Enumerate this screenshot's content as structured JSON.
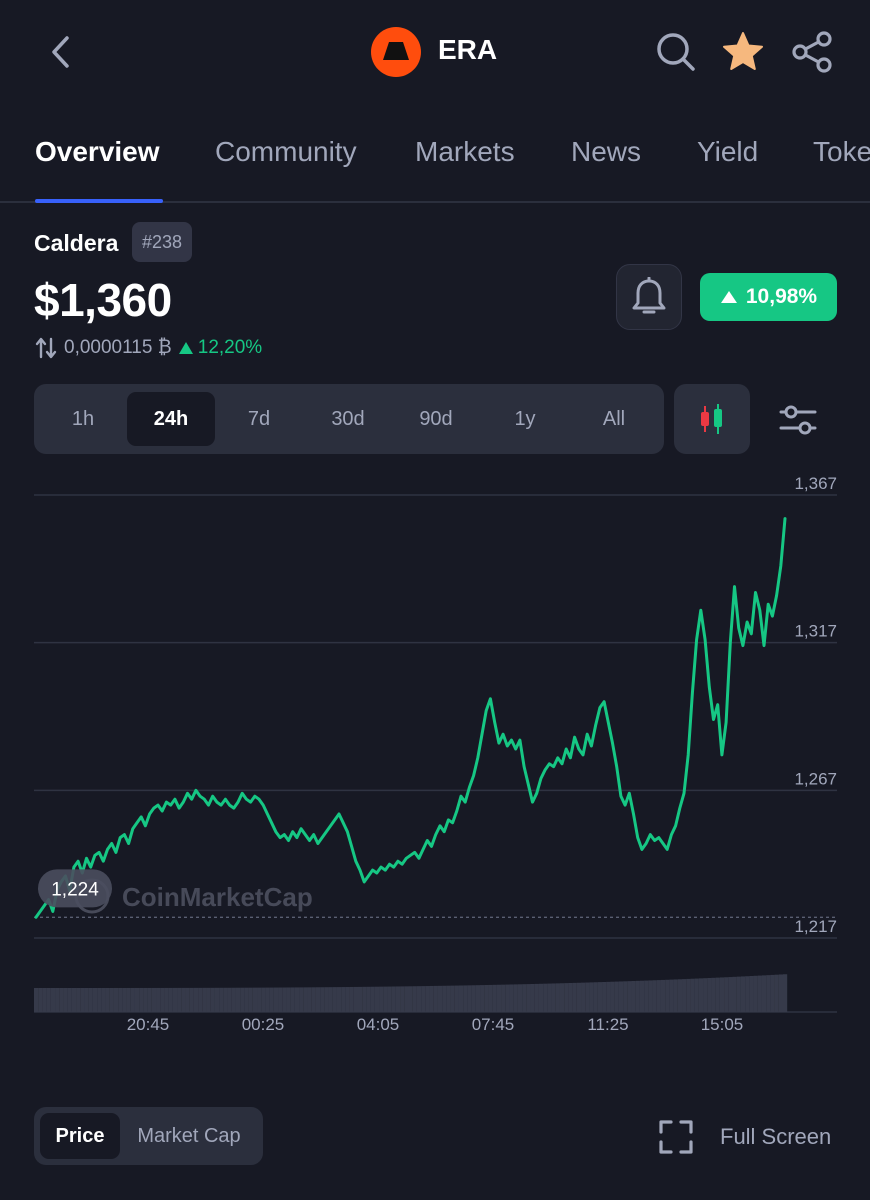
{
  "header": {
    "back_icon": "chevron-left-icon",
    "symbol": "ERA",
    "logo_color": "#ff4d0d",
    "icons": [
      "search-icon",
      "star-icon",
      "share-icon"
    ],
    "star_color": "#f6b87e"
  },
  "tabs": [
    {
      "label": "Overview",
      "active": true
    },
    {
      "label": "Community",
      "active": false
    },
    {
      "label": "Markets",
      "active": false
    },
    {
      "label": "News",
      "active": false
    },
    {
      "label": "Yield",
      "active": false
    },
    {
      "label": "Toke",
      "active": false
    }
  ],
  "coin": {
    "name": "Caldera",
    "rank": "#238",
    "price": "$1,360",
    "btc_price": "0,0000115 ₿",
    "btc_change": "12,20%",
    "change_24h": "10,98%"
  },
  "colors": {
    "positive": "#16c784",
    "accent": "#3861fb",
    "background": "#171924",
    "panel": "#2b2f3d",
    "muted_text": "#a1a7bb"
  },
  "ranges": [
    {
      "label": "1h",
      "active": false
    },
    {
      "label": "24h",
      "active": true
    },
    {
      "label": "7d",
      "active": false
    },
    {
      "label": "30d",
      "active": false
    },
    {
      "label": "90d",
      "active": false
    },
    {
      "label": "1y",
      "active": false
    },
    {
      "label": "All",
      "active": false
    }
  ],
  "chart_data": {
    "type": "line",
    "y_ticks": [
      "1,367",
      "1,317",
      "1,267",
      "1,217"
    ],
    "ylim": [
      1217,
      1367
    ],
    "x_ticks": [
      "20:45",
      "00:25",
      "04:05",
      "07:45",
      "11:25",
      "15:05"
    ],
    "start_price_label": "1,224",
    "start_price": 1224,
    "watermark": "CoinMarketCap",
    "line_color": "#16c784",
    "series": [
      {
        "values": [
          1224,
          1226,
          1228,
          1230,
          1226,
          1233,
          1236,
          1238,
          1233,
          1241,
          1243,
          1239,
          1244,
          1241,
          1245,
          1246,
          1243,
          1247,
          1249,
          1246,
          1251,
          1252,
          1249,
          1254,
          1256,
          1258,
          1255,
          1259,
          1261,
          1262,
          1260,
          1263,
          1262,
          1264,
          1261,
          1263,
          1266,
          1264,
          1267,
          1265,
          1264,
          1262,
          1265,
          1263,
          1262,
          1264,
          1262,
          1261,
          1263,
          1266,
          1264,
          1263,
          1265,
          1264,
          1262,
          1259,
          1256,
          1253,
          1251,
          1252,
          1250,
          1253,
          1251,
          1254,
          1252,
          1250,
          1252,
          1249,
          1251,
          1253,
          1255,
          1257,
          1259,
          1256,
          1253,
          1248,
          1243,
          1240,
          1236,
          1238,
          1240,
          1239,
          1241,
          1240,
          1242,
          1241,
          1243,
          1242,
          1244,
          1245,
          1246,
          1244,
          1247,
          1250,
          1248,
          1252,
          1255,
          1253,
          1257,
          1256,
          1260,
          1265,
          1263,
          1268,
          1272,
          1278,
          1286,
          1294,
          1298,
          1290,
          1283,
          1286,
          1282,
          1284,
          1281,
          1284,
          1275,
          1269,
          1263,
          1266,
          1271,
          1274,
          1276,
          1275,
          1278,
          1276,
          1281,
          1278,
          1285,
          1281,
          1279,
          1286,
          1282,
          1289,
          1295,
          1297,
          1290,
          1283,
          1275,
          1265,
          1262,
          1266,
          1259,
          1251,
          1247,
          1249,
          1252,
          1250,
          1251,
          1249,
          1247,
          1252,
          1255,
          1261,
          1266,
          1279,
          1300,
          1318,
          1328,
          1318,
          1302,
          1291,
          1296,
          1279,
          1290,
          1317,
          1336,
          1322,
          1316,
          1324,
          1320,
          1334,
          1328,
          1316,
          1330,
          1326,
          1333,
          1343,
          1359
        ]
      }
    ]
  },
  "bottom": {
    "segments": [
      {
        "label": "Price",
        "active": true
      },
      {
        "label": "Market Cap",
        "active": false
      }
    ],
    "fullscreen_label": "Full Screen"
  }
}
